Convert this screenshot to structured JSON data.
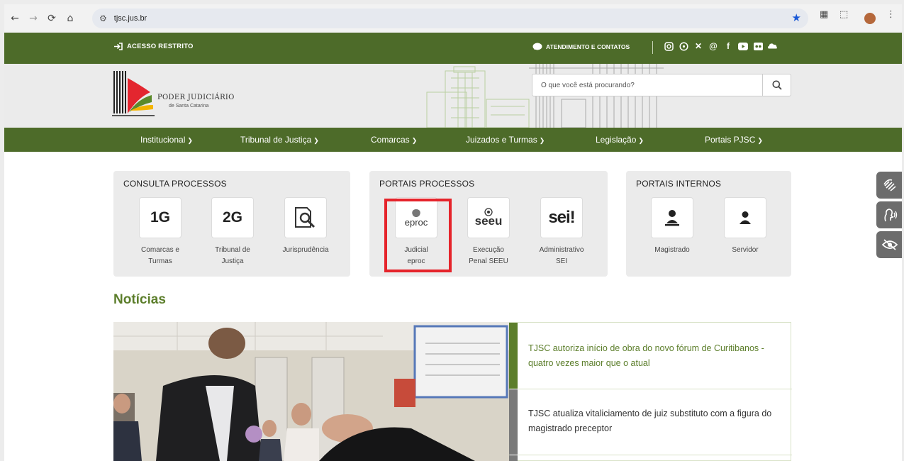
{
  "browser": {
    "url": "tjsc.jus.br"
  },
  "topbar": {
    "acesso_label": "ACESSO RESTRITO",
    "atendimento_label": "ATENDIMENTO E CONTATOS"
  },
  "header": {
    "logo_line1": "PODER JUDICIÁRIO",
    "logo_line2": "de Santa Catarina",
    "search_placeholder": "O que você está procurando?"
  },
  "nav": {
    "items": [
      {
        "label": "Institucional"
      },
      {
        "label": "Tribunal de Justiça"
      },
      {
        "label": "Comarcas"
      },
      {
        "label": "Juizados e Turmas"
      },
      {
        "label": "Legislação"
      },
      {
        "label": "Portais PJSC"
      }
    ]
  },
  "consulta": {
    "title": "CONSULTA PROCESSOS",
    "tiles": [
      {
        "icon_text": "1G",
        "label_line1": "Comarcas e",
        "label_line2": "Turmas"
      },
      {
        "icon_text": "2G",
        "label_line1": "Tribunal de",
        "label_line2": "Justiça"
      },
      {
        "label_line1": "Jurisprudência",
        "label_line2": ""
      }
    ]
  },
  "portais_processos": {
    "title": "PORTAIS PROCESSOS",
    "tiles": [
      {
        "icon_text": "eproc",
        "label_line1": "Judicial",
        "label_line2": "eproc"
      },
      {
        "icon_text": "seeu",
        "label_line1": "Execução",
        "label_line2": "Penal SEEU"
      },
      {
        "icon_text": "sei!",
        "label_line1": "Administrativo",
        "label_line2": "SEI"
      }
    ]
  },
  "portais_internos": {
    "title": "PORTAIS INTERNOS",
    "tiles": [
      {
        "label_line1": "Magistrado",
        "label_line2": ""
      },
      {
        "label_line1": "Servidor",
        "label_line2": ""
      }
    ]
  },
  "news": {
    "heading": "Notícias",
    "items": [
      {
        "title": "TJSC autoriza início de obra do novo fórum de Curitibanos - quatro vezes maior que o atual",
        "active": true
      },
      {
        "title": "TJSC atualiza vitaliciamento de juiz substituto com a figura do magistrado preceptor",
        "active": false
      }
    ]
  },
  "colors": {
    "brand_green": "#4d6b29",
    "news_green": "#5c7e2b",
    "highlight_red": "#e5242b"
  }
}
